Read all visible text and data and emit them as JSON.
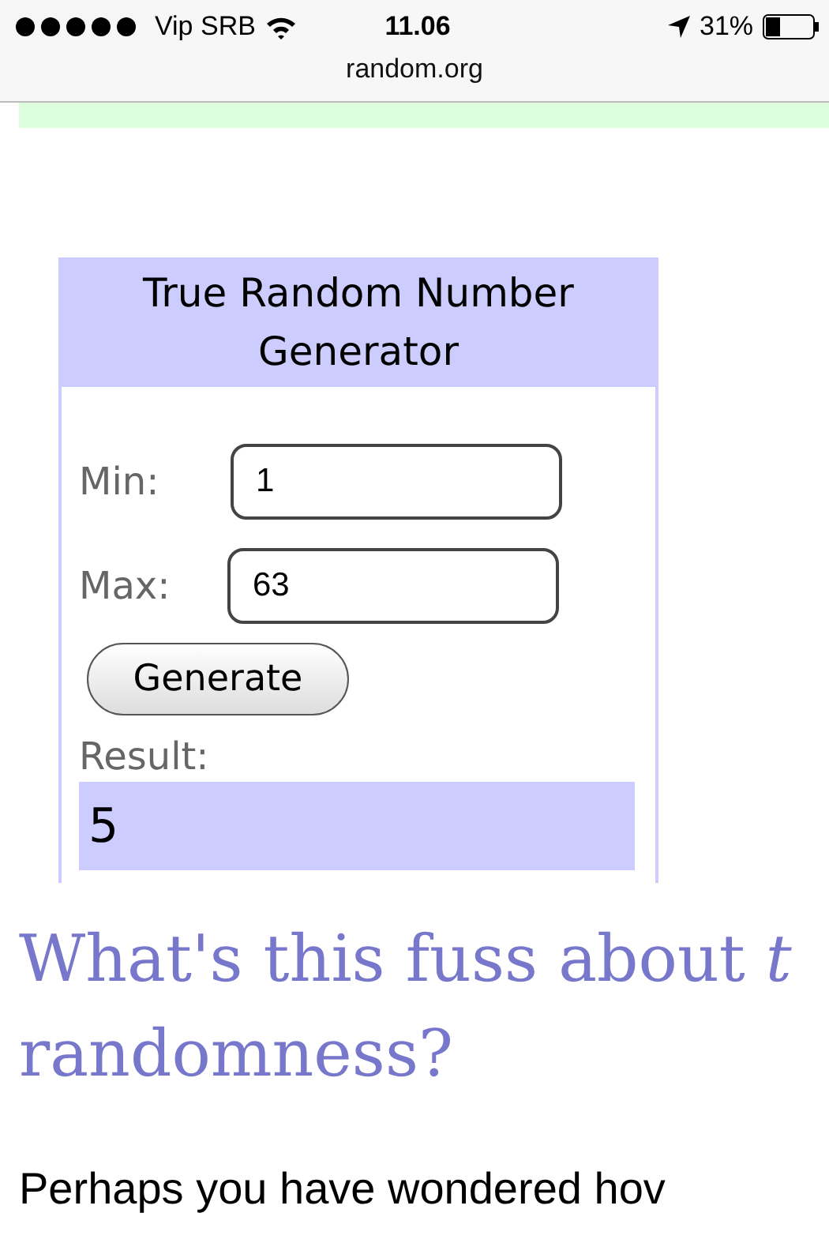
{
  "status_bar": {
    "carrier": "Vip SRB",
    "time": "11.06",
    "battery": "31%",
    "url": "random.org"
  },
  "widget": {
    "title": "True Random Number Generator",
    "fields": [
      {
        "label": "Min:",
        "value": "1"
      },
      {
        "label": "Max:",
        "value": "63"
      }
    ],
    "button": "Generate",
    "result_label": "Result:",
    "result": "5"
  },
  "heading": [
    "What's this fuss about *t*",
    "randomness?"
  ],
  "paragraph": "Perhaps you have wondered hov"
}
